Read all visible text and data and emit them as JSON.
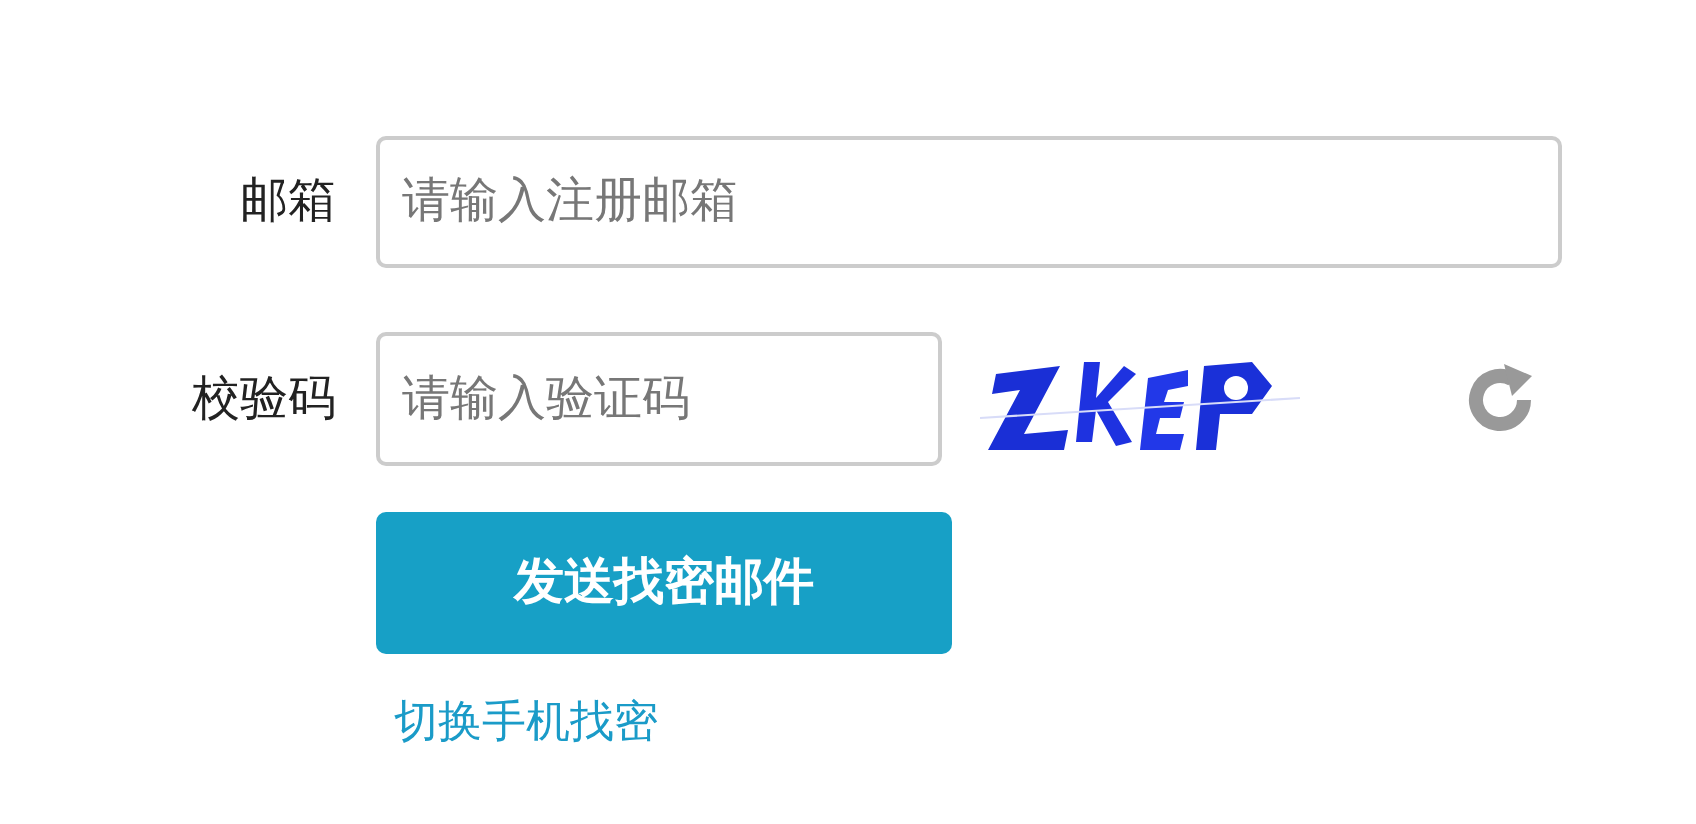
{
  "email": {
    "label": "邮箱",
    "placeholder": "请输入注册邮箱"
  },
  "captcha": {
    "label": "校验码",
    "placeholder": "请输入验证码"
  },
  "submit_button": "发送找密邮件",
  "switch_link": "切换手机找密"
}
